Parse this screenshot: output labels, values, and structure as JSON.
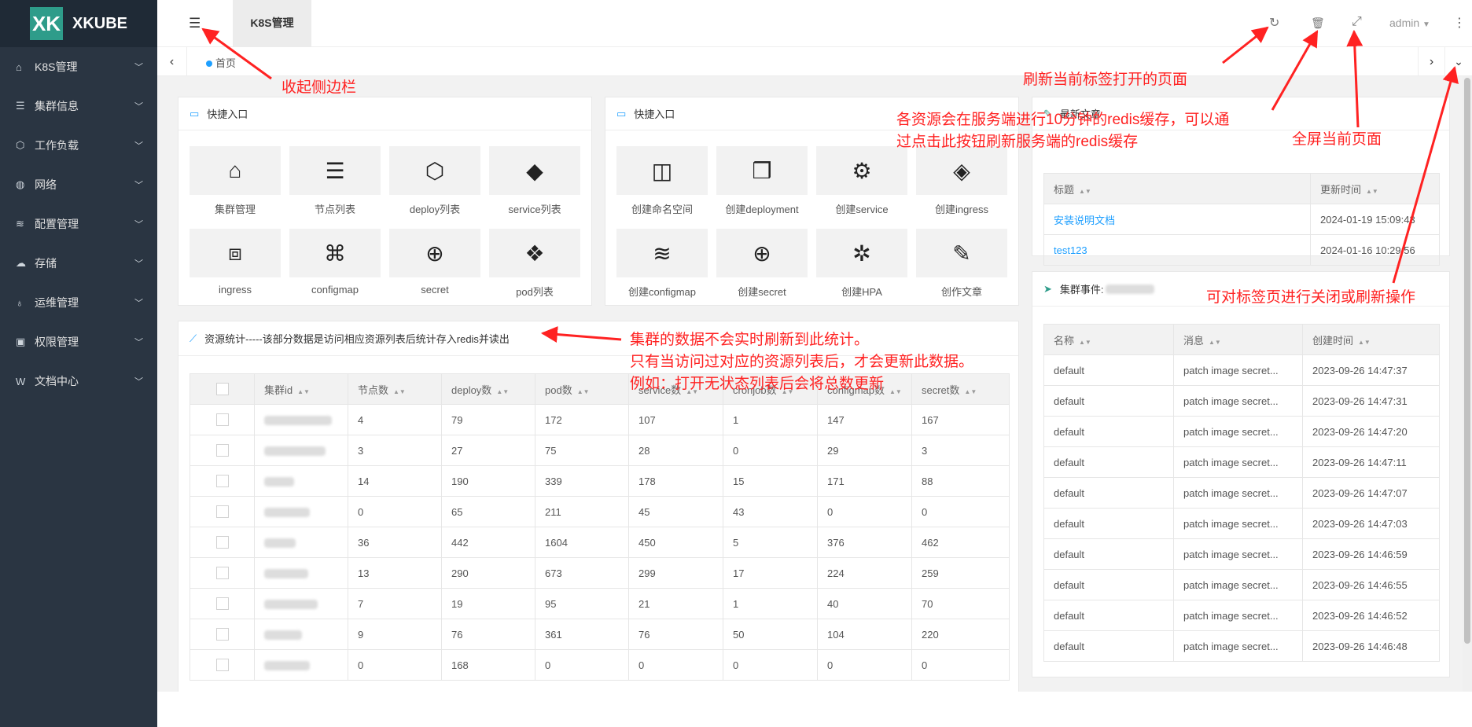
{
  "app": {
    "logo_letters": "XK",
    "name": "XKUBE",
    "accent": "#2e9c8a",
    "sidebar_bg": "#2a3542"
  },
  "sidebar": {
    "items": [
      {
        "icon": "home-icon",
        "glyph": "⌂",
        "label": "K8S管理"
      },
      {
        "icon": "server-icon",
        "glyph": "☰",
        "label": "集群信息"
      },
      {
        "icon": "codepen-icon",
        "glyph": "⬡",
        "label": "工作负载"
      },
      {
        "icon": "globe-icon",
        "glyph": "◍",
        "label": "网络"
      },
      {
        "icon": "database-icon",
        "glyph": "≋",
        "label": "配置管理"
      },
      {
        "icon": "cloud-icon",
        "glyph": "☁",
        "label": "存储"
      },
      {
        "icon": "flask-icon",
        "glyph": "♁",
        "label": "运维管理"
      },
      {
        "icon": "lock-icon",
        "glyph": "▣",
        "label": "权限管理"
      },
      {
        "icon": "wikipedia-icon",
        "glyph": "W",
        "label": "文档中心"
      }
    ]
  },
  "header": {
    "toggle_glyph": "☰",
    "active_tab": "K8S管理",
    "refresh_glyph": "↻",
    "trash_glyph": "🗑",
    "fullscreen_glyph": "⤢",
    "user": "admin",
    "more_glyph": "⋮"
  },
  "tabbar": {
    "home": "首页",
    "left_glyph": "‹",
    "right_glyph": "›",
    "down_glyph": "⌄"
  },
  "quick1": {
    "title": "快捷入口",
    "items": [
      {
        "icon": "home-icon",
        "glyph": "⌂",
        "label": "集群管理"
      },
      {
        "icon": "server-icon",
        "glyph": "☰",
        "label": "节点列表"
      },
      {
        "icon": "codepen-icon",
        "glyph": "⬡",
        "label": "deploy列表"
      },
      {
        "icon": "cube-icon",
        "glyph": "◆",
        "label": "service列表"
      },
      {
        "icon": "object-group-icon",
        "glyph": "⧈",
        "label": "ingress"
      },
      {
        "icon": "file-code-icon",
        "glyph": "⌘",
        "label": "configmap"
      },
      {
        "icon": "lock-icon",
        "glyph": "⊕",
        "label": "secret"
      },
      {
        "icon": "cubes-icon",
        "glyph": "❖",
        "label": "pod列表"
      }
    ]
  },
  "quick2": {
    "title": "快捷入口",
    "items": [
      {
        "icon": "columns-icon",
        "glyph": "◫",
        "label": "创建命名空间"
      },
      {
        "icon": "dropbox-icon",
        "glyph": "❒",
        "label": "创建deployment"
      },
      {
        "icon": "cogs-icon",
        "glyph": "⚙",
        "label": "创建service"
      },
      {
        "icon": "ingress-icon",
        "glyph": "◈",
        "label": "创建ingress"
      },
      {
        "icon": "database-icon",
        "glyph": "≋",
        "label": "创建configmap"
      },
      {
        "icon": "lock-icon",
        "glyph": "⊕",
        "label": "创建secret"
      },
      {
        "icon": "empire-icon",
        "glyph": "✲",
        "label": "创建HPA"
      },
      {
        "icon": "edit-icon",
        "glyph": "✎",
        "label": "创作文章"
      }
    ]
  },
  "stats": {
    "title": "资源统计-----该部分数据是访问相应资源列表后统计存入redis并读出",
    "columns": [
      "集群id",
      "节点数",
      "deploy数",
      "pod数",
      "service数",
      "cronjob数",
      "configmap数",
      "secret数"
    ],
    "rows": [
      [
        "4",
        "79",
        "172",
        "107",
        "1",
        "147",
        "167"
      ],
      [
        "3",
        "27",
        "75",
        "28",
        "0",
        "29",
        "3"
      ],
      [
        "14",
        "190",
        "339",
        "178",
        "15",
        "171",
        "88"
      ],
      [
        "0",
        "65",
        "211",
        "45",
        "43",
        "0",
        "0"
      ],
      [
        "36",
        "442",
        "1604",
        "450",
        "5",
        "376",
        "462"
      ],
      [
        "13",
        "290",
        "673",
        "299",
        "17",
        "224",
        "259"
      ],
      [
        "7",
        "19",
        "95",
        "21",
        "1",
        "40",
        "70"
      ],
      [
        "9",
        "76",
        "361",
        "76",
        "50",
        "104",
        "220"
      ],
      [
        "0",
        "168",
        "0",
        "0",
        "0",
        "0",
        "0"
      ]
    ]
  },
  "articles": {
    "title": "最新文章",
    "columns": [
      "标题",
      "更新时间"
    ],
    "rows": [
      [
        "安装说明文档",
        "2024-01-19 15:09:43"
      ],
      [
        "test123",
        "2024-01-16 10:29:56"
      ]
    ]
  },
  "events": {
    "title": "集群事件:",
    "columns": [
      "名称",
      "消息",
      "创建时间"
    ],
    "rows": [
      [
        "default",
        "patch image secret...",
        "2023-09-26 14:47:37"
      ],
      [
        "default",
        "patch image secret...",
        "2023-09-26 14:47:31"
      ],
      [
        "default",
        "patch image secret...",
        "2023-09-26 14:47:20"
      ],
      [
        "default",
        "patch image secret...",
        "2023-09-26 14:47:11"
      ],
      [
        "default",
        "patch image secret...",
        "2023-09-26 14:47:07"
      ],
      [
        "default",
        "patch image secret...",
        "2023-09-26 14:47:03"
      ],
      [
        "default",
        "patch image secret...",
        "2023-09-26 14:46:59"
      ],
      [
        "default",
        "patch image secret...",
        "2023-09-26 14:46:55"
      ],
      [
        "default",
        "patch image secret...",
        "2023-09-26 14:46:52"
      ],
      [
        "default",
        "patch image secret...",
        "2023-09-26 14:46:48"
      ]
    ]
  },
  "annotations": {
    "collapse": "收起侧边栏",
    "refresh": "刷新当前标签打开的页面",
    "redis_1": "各资源会在服务端进行10分钟的redis缓存，可以通",
    "redis_2": "过点击此按钮刷新服务端的redis缓存",
    "fullscreen": "全屏当前页面",
    "tab_ops": "可对标签页进行关闭或刷新操作",
    "stats_1": "集群的数据不会实时刷新到此统计。",
    "stats_2": "只有当访问过对应的资源列表后，才会更新此数据。",
    "stats_3": "例如：打开无状态列表后会将总数更新"
  }
}
